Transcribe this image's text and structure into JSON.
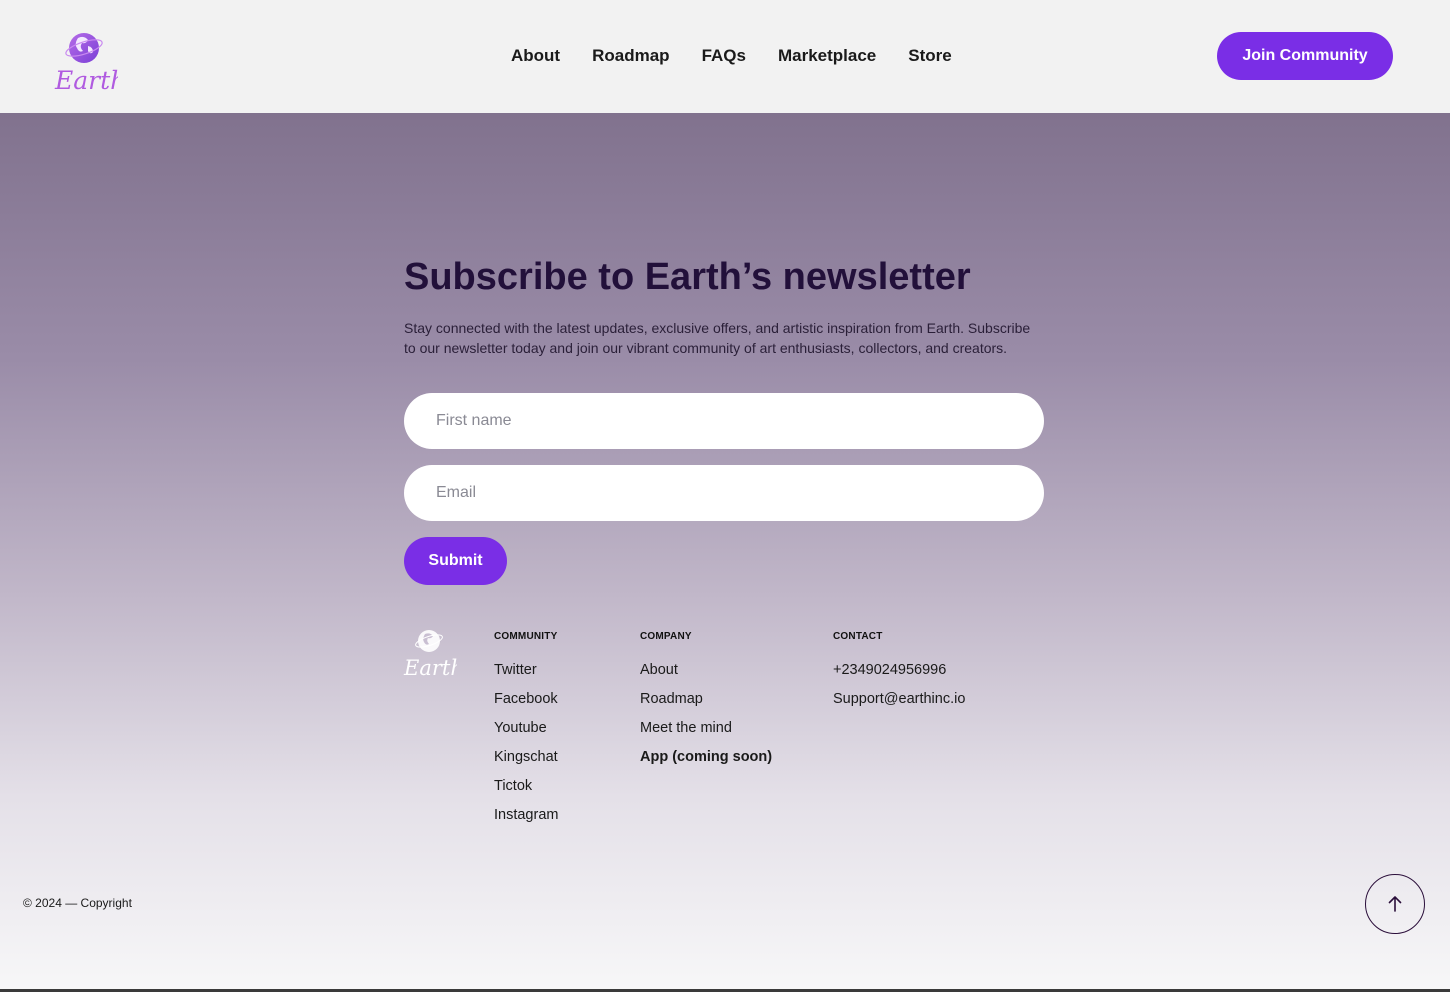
{
  "header": {
    "logo_text": "Earth",
    "nav": [
      "About",
      "Roadmap",
      "FAQs",
      "Marketplace",
      "Store"
    ],
    "cta": "Join Community"
  },
  "newsletter": {
    "title": "Subscribe to Earth’s newsletter",
    "description": "Stay connected with the latest updates, exclusive offers, and artistic inspiration from Earth. Subscribe to our newsletter today and join our vibrant community of art enthusiasts, collectors, and creators.",
    "first_name_placeholder": "First name",
    "email_placeholder": "Email",
    "submit": "Submit"
  },
  "footer": {
    "community": {
      "heading": "COMMUNITY",
      "links": [
        "Twitter",
        "Facebook",
        "Youtube",
        "Kingschat",
        "Tictok",
        "Instagram"
      ]
    },
    "company": {
      "heading": "COMPANY",
      "links": [
        "About",
        "Roadmap",
        "Meet the mind",
        "App (coming soon)"
      ]
    },
    "contact": {
      "heading": "CONTACT",
      "links": [
        "+2349024956996",
        "Support@earthinc.io"
      ]
    },
    "copyright": "© 2024 — Copyright"
  },
  "icons": {
    "back_to_top": "arrow-up-icon",
    "logo": "globe-logo-icon"
  },
  "colors": {
    "accent": "#7a2ee6",
    "title": "#22103a"
  }
}
